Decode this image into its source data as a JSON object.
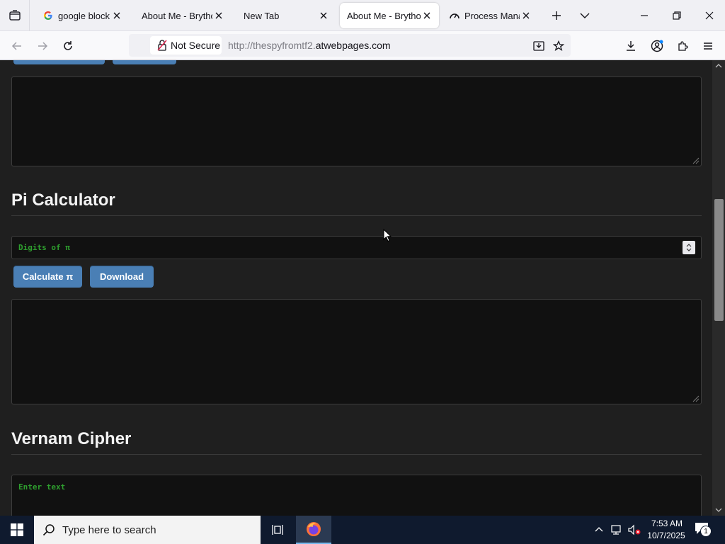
{
  "browser": {
    "tabs": [
      {
        "title": "google block br",
        "favicon": "google-g-icon",
        "active": false
      },
      {
        "title": "About Me - Brython",
        "favicon": "none",
        "active": false
      },
      {
        "title": "New Tab",
        "favicon": "none",
        "active": false
      },
      {
        "title": "About Me - Brython",
        "favicon": "none",
        "active": true
      },
      {
        "title": "Process Manage",
        "favicon": "gauge-icon",
        "active": false
      }
    ],
    "security_label": "Not Secure",
    "url_prefix": "http://thespyfromtf2.",
    "url_domain": "atwebpages.com"
  },
  "page": {
    "pi_section": {
      "heading": "Pi Calculator",
      "input_placeholder": "Digits of π",
      "calculate_label": "Calculate π",
      "download_label": "Download"
    },
    "vernam_section": {
      "heading": "Vernam Cipher",
      "input_placeholder": "Enter text"
    }
  },
  "taskbar": {
    "search_placeholder": "Type here to search",
    "time": "7:53 AM",
    "date": "10/7/2025",
    "notification_count": "1"
  },
  "colors": {
    "button_blue": "#4a7fb5",
    "placeholder_green": "#2e9e2e",
    "page_bg": "#1f1f1f",
    "textarea_bg": "#111111"
  }
}
